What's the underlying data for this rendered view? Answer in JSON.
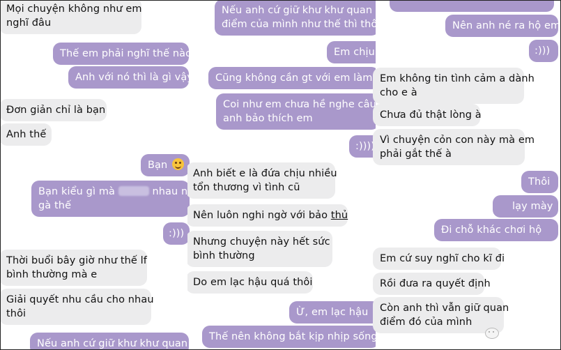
{
  "column1": [
    {
      "side": "in",
      "lines": [
        "Mọi chuyện không như em",
        "nghĩ đâu"
      ]
    },
    {
      "side": "out",
      "lines": [
        "Thế em phải nghĩ thế nào"
      ]
    },
    {
      "side": "out",
      "lines": [
        "Anh với nó thì là gì vậy"
      ]
    },
    {
      "side": "in",
      "lines": [
        "Đơn giản chỉ là bạn"
      ]
    },
    {
      "side": "in",
      "lines": [
        "Anh thế"
      ]
    },
    {
      "side": "out",
      "lines": [
        "Bạn"
      ],
      "emoji": "smiling-emoji"
    },
    {
      "side": "out",
      "lines": [
        "Bạn kiểu gì mà",
        "nhau như",
        "gà thế"
      ]
    },
    {
      "side": "out",
      "lines": [
        ":)))"
      ]
    },
    {
      "side": "in",
      "lines": [
        "Thời buổi bây giờ như thế lf",
        "bình thường mà e"
      ]
    },
    {
      "side": "in",
      "lines": [
        "Giải quyết nhu cầu cho nhau",
        "thôi"
      ]
    },
    {
      "side": "out",
      "lines": [
        "Nếu anh cứ giữ khư khư quan"
      ]
    }
  ],
  "column2": [
    {
      "side": "out",
      "lines": [
        "Nếu anh cứ giữ khư khư quan",
        "điểm của mình như thế thì thôi"
      ]
    },
    {
      "side": "out",
      "lines": [
        "Em chịu"
      ]
    },
    {
      "side": "out",
      "lines": [
        "Cũng không cần gt với em làm gì"
      ]
    },
    {
      "side": "out",
      "lines": [
        "Coi như em chưa hề nghe câu",
        "anh bảo thích em"
      ]
    },
    {
      "side": "out",
      "lines": [
        ":))))"
      ]
    },
    {
      "side": "in",
      "lines": [
        "Anh biết e là đứa chịu nhiều",
        "tổn thương vì tình cũ"
      ]
    },
    {
      "side": "in",
      "lines": [
        "Nên luôn nghi ngờ với bảo",
        "thủ"
      ]
    },
    {
      "side": "in",
      "lines": [
        "Nhưng chuyện này hết sức",
        "bình thường"
      ]
    },
    {
      "side": "in",
      "lines": [
        "Do em lạc hậu quá thôi"
      ]
    },
    {
      "side": "out",
      "lines": [
        "Ừ, em lạc hậu"
      ]
    },
    {
      "side": "out",
      "lines": [
        "Thế nên không bắt kịp nhịp sống"
      ]
    }
  ],
  "column3": [
    {
      "side": "out",
      "lines": [
        "Nên anh né ra hộ em"
      ]
    },
    {
      "side": "out",
      "lines": [
        ":)))"
      ]
    },
    {
      "side": "in",
      "lines": [
        "Em không tin tình cảm a dành",
        "cho e à"
      ]
    },
    {
      "side": "in",
      "lines": [
        "Chưa đủ thật lòng à"
      ]
    },
    {
      "side": "in",
      "lines": [
        "Vì chuyện cỏn con này mà em",
        "phải gắt thế à"
      ]
    },
    {
      "side": "out",
      "lines": [
        "Thôi"
      ]
    },
    {
      "side": "out",
      "lines": [
        "lạy mày"
      ]
    },
    {
      "side": "out",
      "lines": [
        "Đi chỗ khác chơi hộ"
      ]
    },
    {
      "side": "in",
      "lines": [
        "Em cứ suy nghĩ cho kĩ đi"
      ]
    },
    {
      "side": "in",
      "lines": [
        "Rồi đưa ra quyết định"
      ]
    },
    {
      "side": "in",
      "lines": [
        "Còn anh thì vẫn giữ quan",
        "điểm đó của mình"
      ]
    }
  ],
  "colors": {
    "incoming_bubble": "#ececed",
    "outgoing_bubble": "#a998cb",
    "outgoing_text": "#ffffff",
    "incoming_text": "#111111"
  },
  "icons": [
    "smiling-emoji",
    "blurred-word",
    "add-reaction-icon"
  ]
}
